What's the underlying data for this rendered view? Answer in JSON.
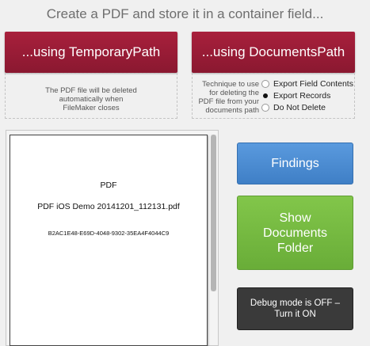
{
  "title": "Create a PDF and store it in a container field...",
  "buttons": {
    "temporary_path": "...using TemporaryPath",
    "documents_path": "...using DocumentsPath",
    "findings": "Findings",
    "show_documents_folder": [
      "Show",
      "Documents",
      "Folder"
    ],
    "debug": [
      "Debug mode is OFF –",
      "Turn it ON"
    ]
  },
  "temp_note": [
    "The PDF file will be deleted",
    "automatically when",
    "FileMaker closes"
  ],
  "technique_label": [
    "Technique to use",
    "for deleting the",
    "PDF file from your",
    "documents path"
  ],
  "radio_options": [
    {
      "label": "Export Field Contents",
      "selected": false
    },
    {
      "label": "Export Records",
      "selected": true
    },
    {
      "label": "Do Not Delete",
      "selected": false
    }
  ],
  "pdf_preview": {
    "line1": "PDF",
    "line2": "PDF iOS Demo 20141201_112131.pdf",
    "line3": "B2AC1E48-E69D-4048-9302-35EA4F4044C9"
  },
  "colors": {
    "red_button": "#9b1c36",
    "blue_button": "#4a8bd3",
    "green_button": "#74b841",
    "dark_button": "#3a3a3a"
  }
}
